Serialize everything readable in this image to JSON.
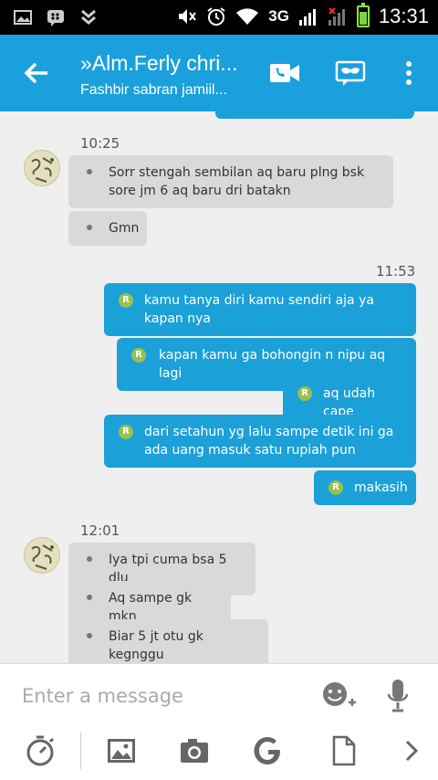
{
  "status": {
    "network": "3G",
    "time": "13:31"
  },
  "header": {
    "title": "»Alm.Ferly chri...",
    "subtitle": "Fashbir sabran jamiil..."
  },
  "chat": {
    "groups": [
      {
        "time": "10:25",
        "direction": "in",
        "messages": [
          "Sorr stengah sembilan aq baru plng bsk sore jm 6 aq baru dri batakn",
          "Gmn"
        ]
      },
      {
        "time": "11:53",
        "direction": "out",
        "status_mark": "R",
        "messages": [
          "kamu tanya diri kamu sendiri aja ya kapan nya",
          "kapan kamu ga bohongin n nipu aq lagi",
          "aq udah cape",
          "dari setahun yg lalu sampe detik ini ga ada uang masuk satu rupiah pun",
          "makasih"
        ]
      },
      {
        "time": "12:01",
        "direction": "in",
        "messages": [
          "Iya tpi cuma bsa 5 dlu",
          "Aq sampe gk mkn",
          "Biar 5 jt otu gk kegnggu"
        ]
      }
    ]
  },
  "input": {
    "placeholder": "Enter a message"
  },
  "colors": {
    "accent": "#1aa0dc",
    "incoming": "#d9d9d9",
    "outgoing": "#1ba0d8",
    "read_mark": "#9bbf4f"
  }
}
